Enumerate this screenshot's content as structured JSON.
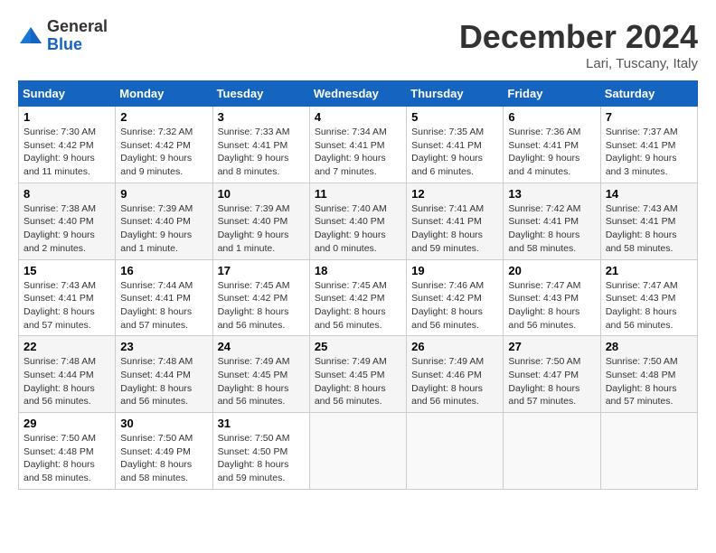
{
  "logo": {
    "general": "General",
    "blue": "Blue"
  },
  "header": {
    "title": "December 2024",
    "location": "Lari, Tuscany, Italy"
  },
  "days_of_week": [
    "Sunday",
    "Monday",
    "Tuesday",
    "Wednesday",
    "Thursday",
    "Friday",
    "Saturday"
  ],
  "weeks": [
    [
      {
        "day": "1",
        "sunrise": "7:30 AM",
        "sunset": "4:42 PM",
        "daylight": "9 hours and 11 minutes."
      },
      {
        "day": "2",
        "sunrise": "7:32 AM",
        "sunset": "4:42 PM",
        "daylight": "9 hours and 9 minutes."
      },
      {
        "day": "3",
        "sunrise": "7:33 AM",
        "sunset": "4:41 PM",
        "daylight": "9 hours and 8 minutes."
      },
      {
        "day": "4",
        "sunrise": "7:34 AM",
        "sunset": "4:41 PM",
        "daylight": "9 hours and 7 minutes."
      },
      {
        "day": "5",
        "sunrise": "7:35 AM",
        "sunset": "4:41 PM",
        "daylight": "9 hours and 6 minutes."
      },
      {
        "day": "6",
        "sunrise": "7:36 AM",
        "sunset": "4:41 PM",
        "daylight": "9 hours and 4 minutes."
      },
      {
        "day": "7",
        "sunrise": "7:37 AM",
        "sunset": "4:41 PM",
        "daylight": "9 hours and 3 minutes."
      }
    ],
    [
      {
        "day": "8",
        "sunrise": "7:38 AM",
        "sunset": "4:40 PM",
        "daylight": "9 hours and 2 minutes."
      },
      {
        "day": "9",
        "sunrise": "7:39 AM",
        "sunset": "4:40 PM",
        "daylight": "9 hours and 1 minute."
      },
      {
        "day": "10",
        "sunrise": "7:39 AM",
        "sunset": "4:40 PM",
        "daylight": "9 hours and 1 minute."
      },
      {
        "day": "11",
        "sunrise": "7:40 AM",
        "sunset": "4:40 PM",
        "daylight": "9 hours and 0 minutes."
      },
      {
        "day": "12",
        "sunrise": "7:41 AM",
        "sunset": "4:41 PM",
        "daylight": "8 hours and 59 minutes."
      },
      {
        "day": "13",
        "sunrise": "7:42 AM",
        "sunset": "4:41 PM",
        "daylight": "8 hours and 58 minutes."
      },
      {
        "day": "14",
        "sunrise": "7:43 AM",
        "sunset": "4:41 PM",
        "daylight": "8 hours and 58 minutes."
      }
    ],
    [
      {
        "day": "15",
        "sunrise": "7:43 AM",
        "sunset": "4:41 PM",
        "daylight": "8 hours and 57 minutes."
      },
      {
        "day": "16",
        "sunrise": "7:44 AM",
        "sunset": "4:41 PM",
        "daylight": "8 hours and 57 minutes."
      },
      {
        "day": "17",
        "sunrise": "7:45 AM",
        "sunset": "4:42 PM",
        "daylight": "8 hours and 56 minutes."
      },
      {
        "day": "18",
        "sunrise": "7:45 AM",
        "sunset": "4:42 PM",
        "daylight": "8 hours and 56 minutes."
      },
      {
        "day": "19",
        "sunrise": "7:46 AM",
        "sunset": "4:42 PM",
        "daylight": "8 hours and 56 minutes."
      },
      {
        "day": "20",
        "sunrise": "7:47 AM",
        "sunset": "4:43 PM",
        "daylight": "8 hours and 56 minutes."
      },
      {
        "day": "21",
        "sunrise": "7:47 AM",
        "sunset": "4:43 PM",
        "daylight": "8 hours and 56 minutes."
      }
    ],
    [
      {
        "day": "22",
        "sunrise": "7:48 AM",
        "sunset": "4:44 PM",
        "daylight": "8 hours and 56 minutes."
      },
      {
        "day": "23",
        "sunrise": "7:48 AM",
        "sunset": "4:44 PM",
        "daylight": "8 hours and 56 minutes."
      },
      {
        "day": "24",
        "sunrise": "7:49 AM",
        "sunset": "4:45 PM",
        "daylight": "8 hours and 56 minutes."
      },
      {
        "day": "25",
        "sunrise": "7:49 AM",
        "sunset": "4:45 PM",
        "daylight": "8 hours and 56 minutes."
      },
      {
        "day": "26",
        "sunrise": "7:49 AM",
        "sunset": "4:46 PM",
        "daylight": "8 hours and 56 minutes."
      },
      {
        "day": "27",
        "sunrise": "7:50 AM",
        "sunset": "4:47 PM",
        "daylight": "8 hours and 57 minutes."
      },
      {
        "day": "28",
        "sunrise": "7:50 AM",
        "sunset": "4:48 PM",
        "daylight": "8 hours and 57 minutes."
      }
    ],
    [
      {
        "day": "29",
        "sunrise": "7:50 AM",
        "sunset": "4:48 PM",
        "daylight": "8 hours and 58 minutes."
      },
      {
        "day": "30",
        "sunrise": "7:50 AM",
        "sunset": "4:49 PM",
        "daylight": "8 hours and 58 minutes."
      },
      {
        "day": "31",
        "sunrise": "7:50 AM",
        "sunset": "4:50 PM",
        "daylight": "8 hours and 59 minutes."
      },
      null,
      null,
      null,
      null
    ]
  ]
}
